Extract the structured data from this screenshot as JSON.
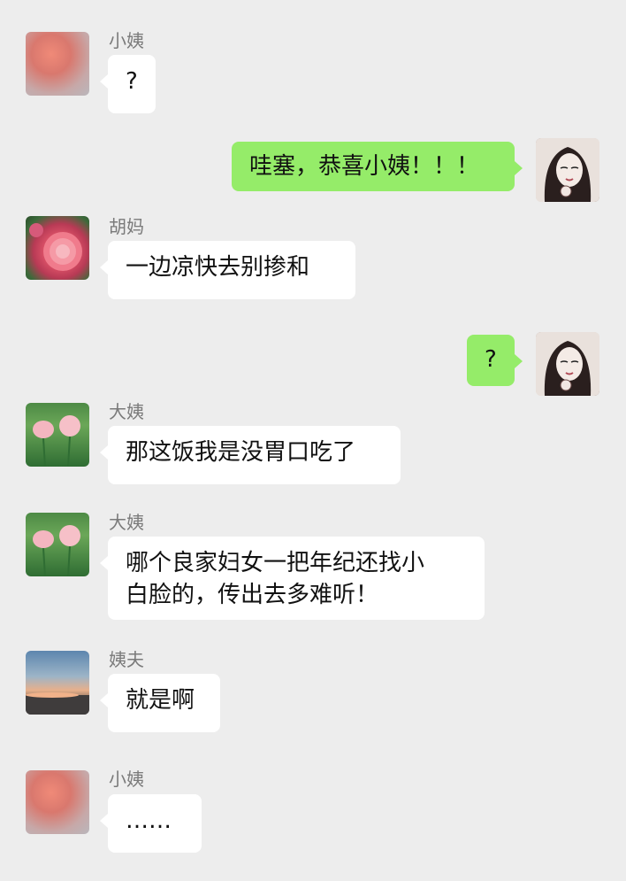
{
  "messages": [
    {
      "sender": "小姨",
      "side": "left",
      "avatar": "avatar-xiaoyi",
      "text": "?"
    },
    {
      "sender": "",
      "side": "right",
      "avatar": "avatar-me",
      "text": "哇塞，恭喜小姨！！！"
    },
    {
      "sender": "胡妈",
      "side": "left",
      "avatar": "avatar-humom",
      "text": "一边凉快去别掺和"
    },
    {
      "sender": "",
      "side": "right",
      "avatar": "avatar-me",
      "text": "?"
    },
    {
      "sender": "大姨",
      "side": "left",
      "avatar": "avatar-dayi",
      "text": "那这饭我是没胃口吃了"
    },
    {
      "sender": "大姨",
      "side": "left",
      "avatar": "avatar-dayi",
      "text_line1": "哪个良家妇女一把年纪还找小",
      "text_line2": "白脸的，传出去多难听！"
    },
    {
      "sender": "姨夫",
      "side": "left",
      "avatar": "avatar-yifu",
      "text": "就是啊"
    },
    {
      "sender": "小姨",
      "side": "left",
      "avatar": "avatar-xiaoyi",
      "text": "……"
    }
  ]
}
